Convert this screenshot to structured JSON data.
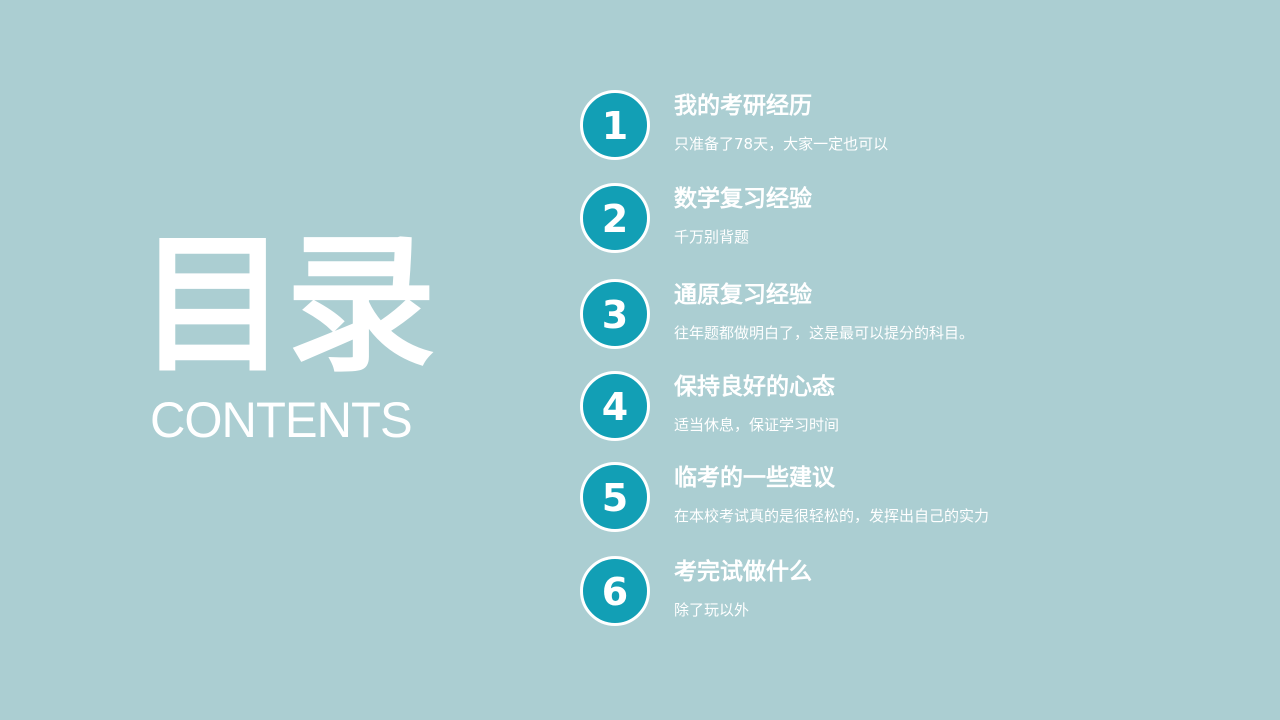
{
  "title": {
    "main": "目录",
    "sub": "CONTENTS"
  },
  "items": [
    {
      "number": "1",
      "title": "我的考研经历",
      "desc": "只准备了78天，大家一定也可以"
    },
    {
      "number": "2",
      "title": "数学复习经验",
      "desc": "千万别背题"
    },
    {
      "number": "3",
      "title": "通原复习经验",
      "desc": "往年题都做明白了，这是最可以提分的科目。"
    },
    {
      "number": "4",
      "title": "保持良好的心态",
      "desc": "适当休息，保证学习时间"
    },
    {
      "number": "5",
      "title": "临考的一些建议",
      "desc": "在本校考试真的是很轻松的，发挥出自己的实力"
    },
    {
      "number": "6",
      "title": "考完试做什么",
      "desc": "除了玩以外"
    }
  ],
  "colors": {
    "background": "#abced2",
    "badge": "#129fb5",
    "text": "#ffffff"
  }
}
